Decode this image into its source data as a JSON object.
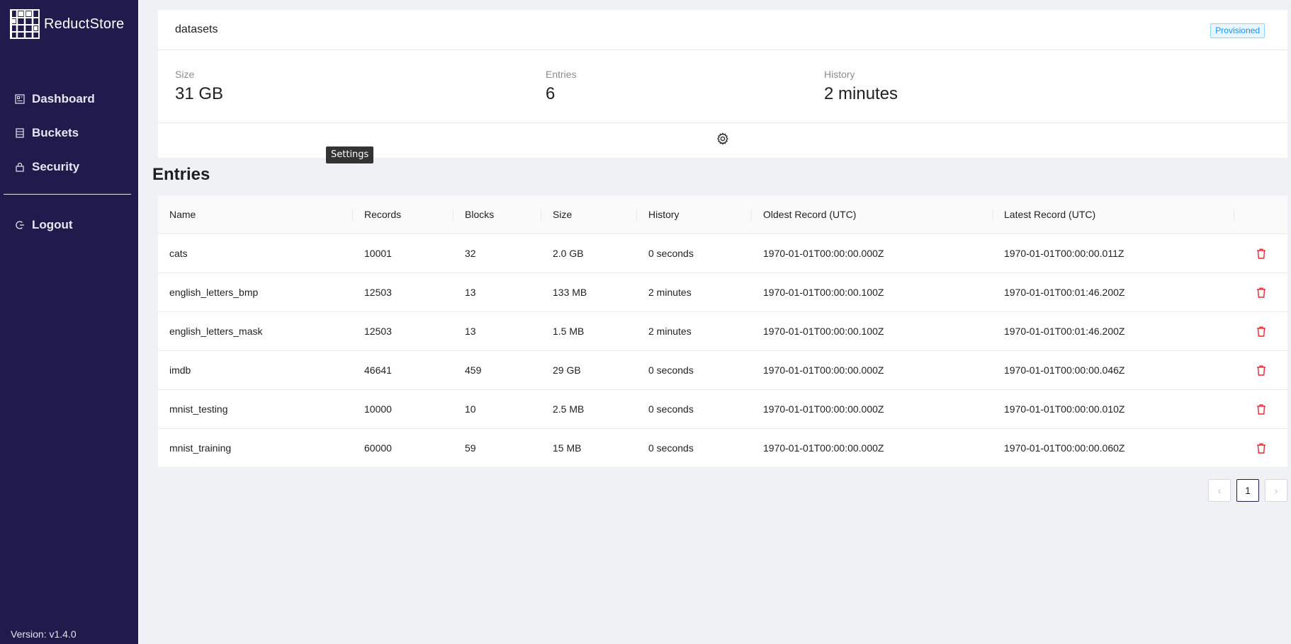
{
  "app": {
    "name": "ReductStore",
    "version": "Version: v1.4.0"
  },
  "sidebar": {
    "items": [
      {
        "label": "Dashboard",
        "icon": "dashboard-icon"
      },
      {
        "label": "Buckets",
        "icon": "database-icon"
      },
      {
        "label": "Security",
        "icon": "lock-icon"
      }
    ],
    "logout": {
      "label": "Logout",
      "icon": "logout-icon"
    }
  },
  "bucket": {
    "name": "datasets",
    "tag": "Provisioned",
    "stats": {
      "size": {
        "title": "Size",
        "value": "31 GB"
      },
      "entries": {
        "title": "Entries",
        "value": "6"
      },
      "history": {
        "title": "History",
        "value": "2 minutes"
      }
    },
    "settings_tooltip": "Settings"
  },
  "entries": {
    "title": "Entries",
    "columns": [
      "Name",
      "Records",
      "Blocks",
      "Size",
      "History",
      "Oldest Record (UTC)",
      "Latest Record (UTC)",
      ""
    ],
    "rows": [
      [
        "cats",
        "10001",
        "32",
        "2.0 GB",
        "0 seconds",
        "1970-01-01T00:00:00.000Z",
        "1970-01-01T00:00:00.011Z"
      ],
      [
        "english_letters_bmp",
        "12503",
        "13",
        "133 MB",
        "2 minutes",
        "1970-01-01T00:00:00.100Z",
        "1970-01-01T00:01:46.200Z"
      ],
      [
        "english_letters_mask",
        "12503",
        "13",
        "1.5 MB",
        "2 minutes",
        "1970-01-01T00:00:00.100Z",
        "1970-01-01T00:01:46.200Z"
      ],
      [
        "imdb",
        "46641",
        "459",
        "29 GB",
        "0 seconds",
        "1970-01-01T00:00:00.000Z",
        "1970-01-01T00:00:00.046Z"
      ],
      [
        "mnist_testing",
        "10000",
        "10",
        "2.5 MB",
        "0 seconds",
        "1970-01-01T00:00:00.000Z",
        "1970-01-01T00:00:00.010Z"
      ],
      [
        "mnist_training",
        "60000",
        "59",
        "15 MB",
        "0 seconds",
        "1970-01-01T00:00:00.000Z",
        "1970-01-01T00:00:00.060Z"
      ]
    ]
  },
  "pagination": {
    "prev": "‹",
    "current": "1",
    "next": "›"
  },
  "colors": {
    "sidebar_bg": "#211a4c",
    "danger": "#f5222d",
    "tag_blue": "#1890ff"
  }
}
